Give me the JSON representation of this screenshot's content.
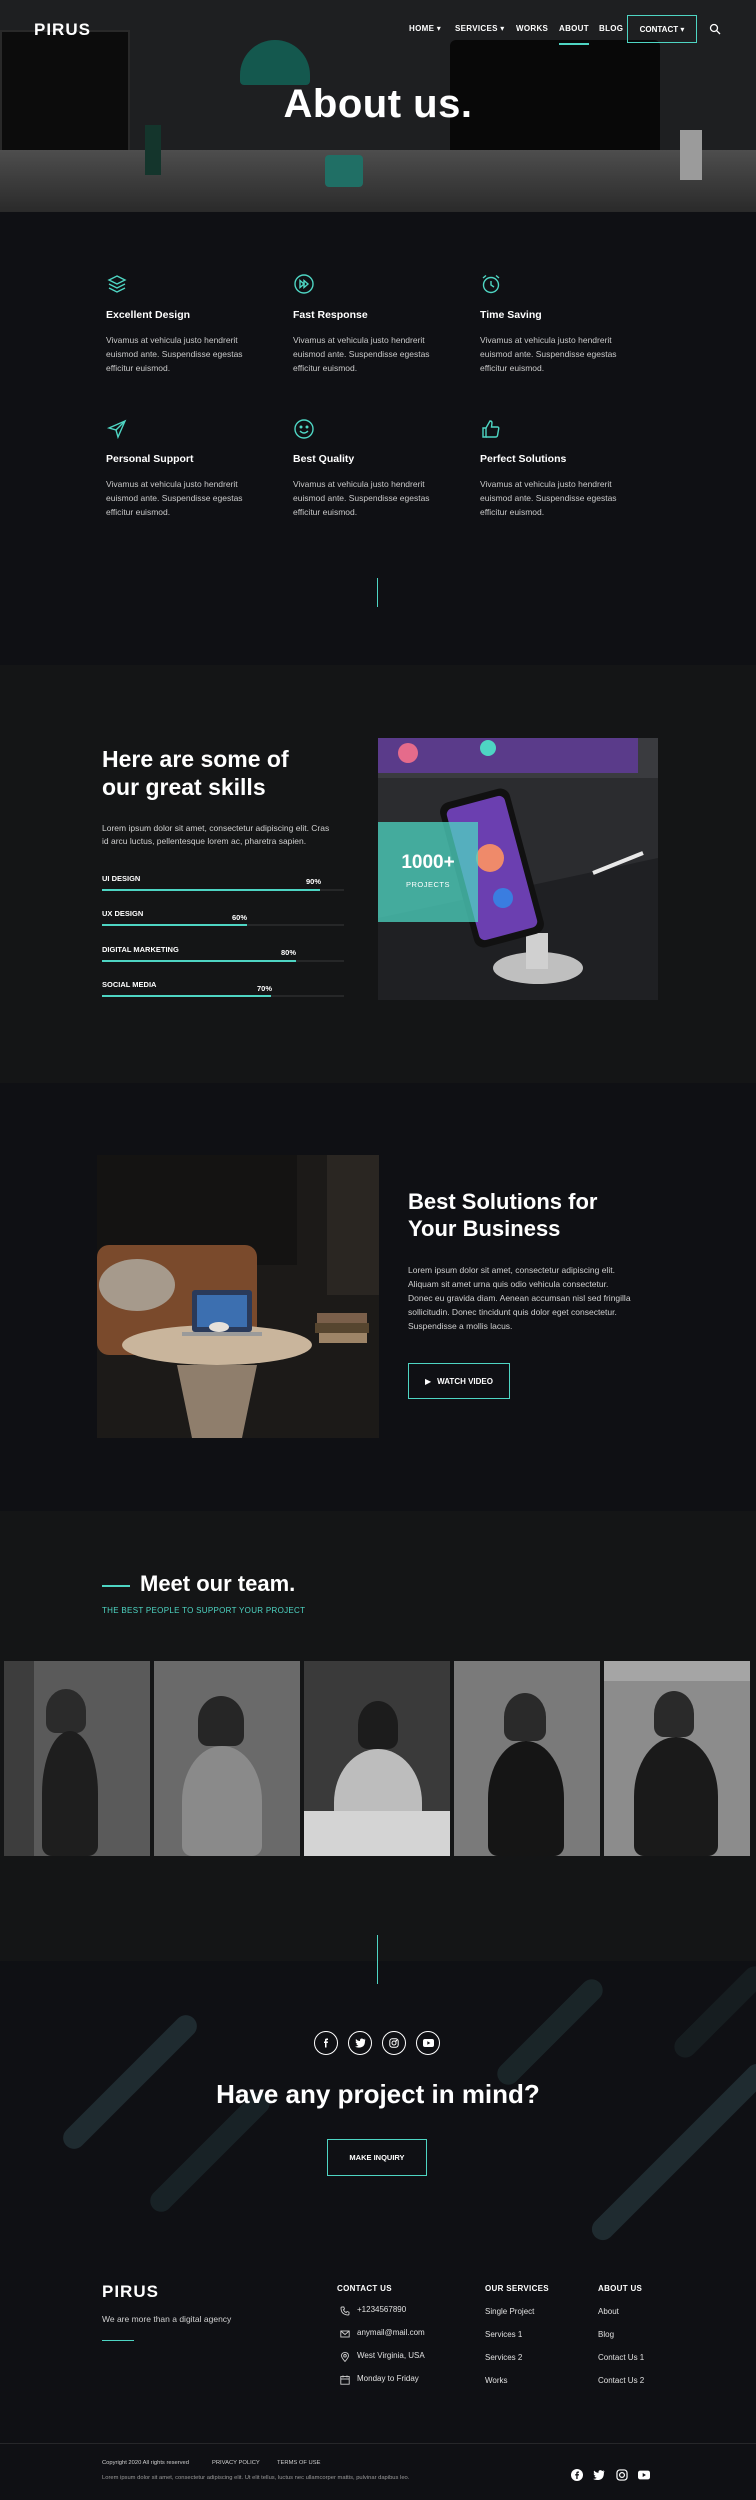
{
  "nav": {
    "logo": "PIRUS",
    "items": [
      "HOME",
      "SERVICES",
      "WORKS",
      "ABOUT",
      "BLOG"
    ],
    "contact": "CONTACT",
    "search_icon": "search-icon",
    "accent": "#4ed5c3"
  },
  "hero": {
    "title": "About us."
  },
  "features": [
    {
      "icon": "layers-icon",
      "title": "Excellent Design",
      "text": "Vivamus at vehicula justo hendrerit euismod ante. Suspendisse egestas efficitur euismod."
    },
    {
      "icon": "fast-forward-icon",
      "title": "Fast Response",
      "text": "Vivamus at vehicula justo hendrerit euismod ante. Suspendisse egestas efficitur euismod."
    },
    {
      "icon": "alarm-clock-icon",
      "title": "Time Saving",
      "text": "Vivamus at vehicula justo hendrerit euismod ante. Suspendisse egestas efficitur euismod."
    },
    {
      "icon": "send-icon",
      "title": "Personal Support",
      "text": "Vivamus at vehicula justo hendrerit euismod ante. Suspendisse egestas efficitur euismod."
    },
    {
      "icon": "smile-icon",
      "title": "Best Quality",
      "text": "Vivamus at vehicula justo hendrerit euismod ante. Suspendisse egestas efficitur euismod."
    },
    {
      "icon": "thumbs-up-icon",
      "title": "Perfect Solutions",
      "text": "Vivamus at vehicula justo hendrerit euismod ante. Suspendisse egestas efficitur euismod."
    }
  ],
  "skills": {
    "title": "Here are some of our great skills",
    "text": "Lorem ipsum dolor sit amet, consectetur adipiscing elit. Cras id arcu luctus, pellentesque lorem ac, pharetra sapien.",
    "items": [
      {
        "label": "UI DESIGN",
        "value": "90%",
        "percent": 90
      },
      {
        "label": "UX DESIGN",
        "value": "60%",
        "percent": 60
      },
      {
        "label": "DIGITAL MARKETING",
        "value": "80%",
        "percent": 80
      },
      {
        "label": "SOCIAL MEDIA",
        "value": "70%",
        "percent": 70
      }
    ],
    "projects_number": "1000+",
    "projects_label": "PROJECTS"
  },
  "solutions": {
    "title": "Best Solutions for Your Business",
    "text": "Lorem ipsum dolor sit amet, consectetur adipiscing elit. Aliquam sit amet urna quis odio vehicula consectetur. Donec eu gravida diam. Aenean accumsan nisl sed fringilla sollicitudin. Donec tincidunt quis dolor eget consectetur. Suspendisse a mollis lacus.",
    "button": "WATCH VIDEO"
  },
  "team": {
    "title": "Meet our team.",
    "subtitle": "THE BEST PEOPLE TO SUPPORT YOUR PROJECT"
  },
  "cta": {
    "title": "Have any project in mind?",
    "button": "MAKE INQUIRY",
    "socials": [
      "facebook-icon",
      "twitter-icon",
      "instagram-icon",
      "youtube-icon"
    ]
  },
  "footer": {
    "logo": "PIRUS",
    "tagline": "We are more than a digital agency",
    "contact_head": "CONTACT US",
    "contact": [
      {
        "icon": "phone-icon",
        "text": "+1234567890"
      },
      {
        "icon": "mail-icon",
        "text": "anymail@mail.com"
      },
      {
        "icon": "location-icon",
        "text": "West Virginia, USA"
      },
      {
        "icon": "calendar-icon",
        "text": "Monday to Friday"
      }
    ],
    "services_head": "OUR SERVICES",
    "services": [
      "Single Project",
      "Services 1",
      "Services 2",
      "Works"
    ],
    "about_head": "ABOUT US",
    "about": [
      "About",
      "Blog",
      "Contact Us 1",
      "Contact Us 2"
    ],
    "copyright": "Copyright 2020 All rights reserved",
    "privacy": "PRIVACY POLICY",
    "terms": "TERMS OF USE",
    "fine_print": "Lorem ipsum dolor sit amet, consectetur adipiscing elit. Ut elit tellus, luctus nec ullamcorper mattis, pulvinar dapibus leo."
  }
}
